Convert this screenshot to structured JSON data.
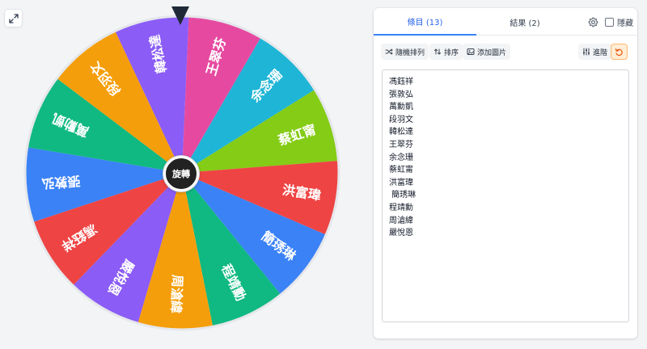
{
  "app": {
    "expand_icon": "expand-arrows-icon"
  },
  "wheel": {
    "center_label": "旋轉",
    "pointer_icon": "pointer-triangle-icon",
    "segments": [
      {
        "name": "王翠芬",
        "color": "#e64aa0"
      },
      {
        "name": "余念珊",
        "color": "#1fb5d6"
      },
      {
        "name": "蔡虹甯",
        "color": "#84cc16"
      },
      {
        "name": "洪富瑋",
        "color": "#ef4444"
      },
      {
        "name": "簡琇琳",
        "color": "#3b82f6"
      },
      {
        "name": "程靖勳",
        "color": "#10b981"
      },
      {
        "name": "周滄緯",
        "color": "#f59e0b"
      },
      {
        "name": "嚴悅恩",
        "color": "#8b5cf6"
      },
      {
        "name": "馮鈺祥",
        "color": "#ef4444"
      },
      {
        "name": "張敦弘",
        "color": "#3b82f6"
      },
      {
        "name": "萬勳凱",
        "color": "#10b981"
      },
      {
        "name": "段羽文",
        "color": "#f59e0b"
      },
      {
        "name": "韓松達",
        "color": "#8b5cf6"
      }
    ]
  },
  "panel": {
    "tabs": {
      "entries": "條目 (13)",
      "results": "結果 (2)"
    },
    "hide_label": "隱藏",
    "settings_icon": "gear-icon",
    "toolbar": {
      "shuffle": "隨機排列",
      "sort": "排序",
      "add_image": "添加圖片",
      "advanced": "進階"
    },
    "entries": [
      "馮鈺祥",
      "張敦弘",
      "萬勳凱",
      "段羽文",
      "韓松達",
      "王翠芬",
      "余念珊",
      "蔡虹甯",
      "洪富瑋",
      " 簡琇琳",
      "程靖勳",
      "周滄緯",
      "嚴悅恩"
    ]
  }
}
